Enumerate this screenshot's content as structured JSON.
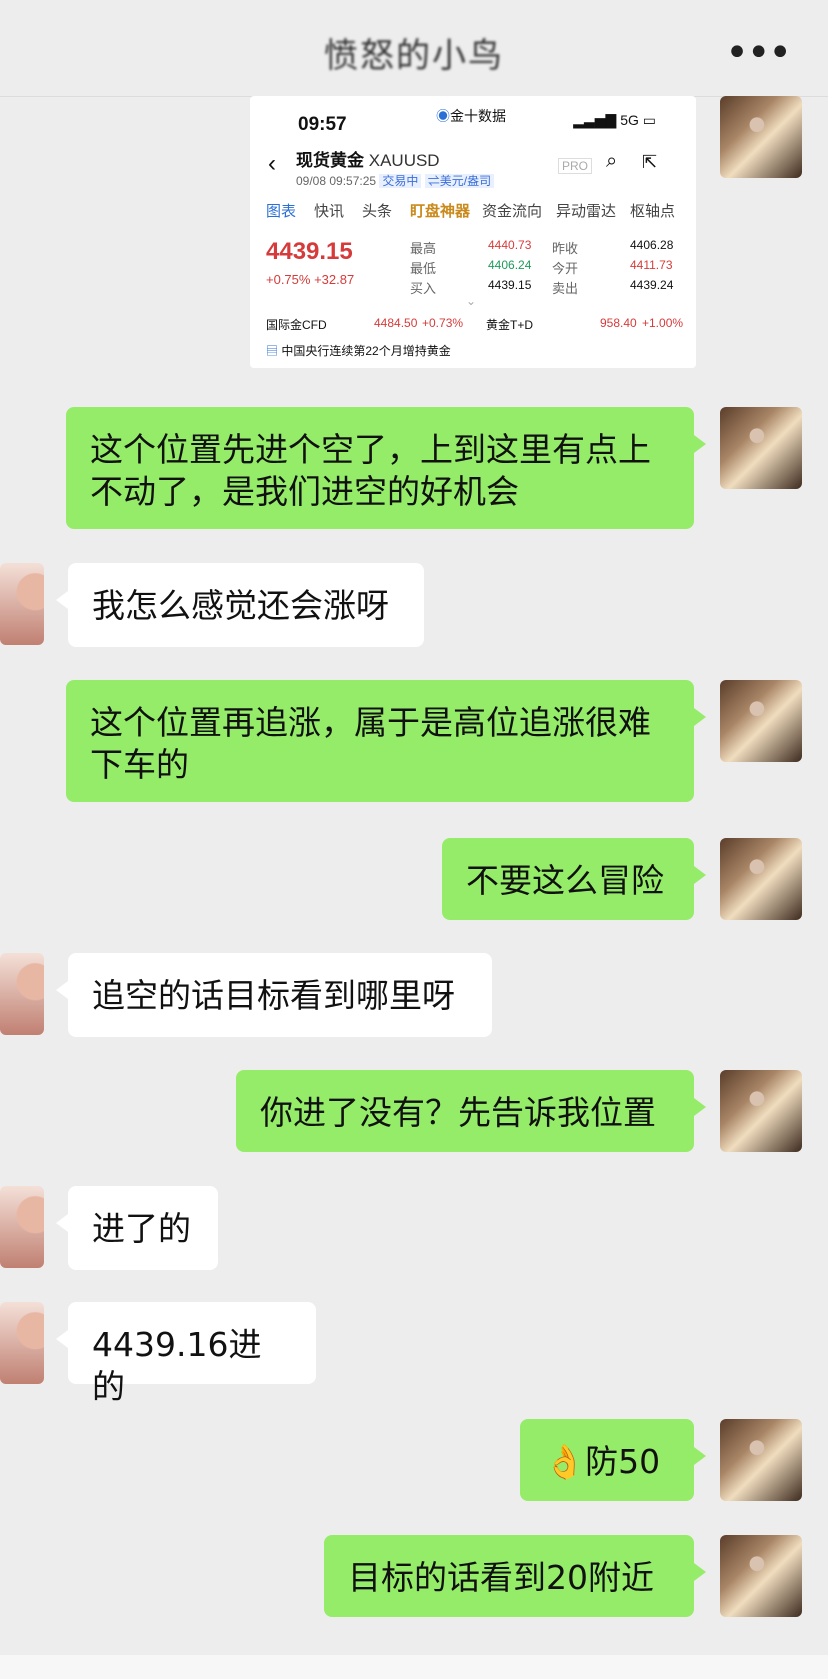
{
  "header": {
    "title": "愤怒的小鸟",
    "more": "•••"
  },
  "quote": {
    "status": {
      "time": "09:57",
      "app": "金十数据",
      "network": "5G"
    },
    "instrument": "现货黄金",
    "symbol": "XAUUSD",
    "datetime": "09/08 09:57:25",
    "badges": [
      "交易中",
      "⇌美元/盎司"
    ],
    "pro": "PRO",
    "tabs": [
      "图表",
      "快讯",
      "头条",
      "盯盘神器",
      "资金流向",
      "异动雷达",
      "枢轴点"
    ],
    "price": "4439.15",
    "change_pct": "+0.75%",
    "change_abs": "+32.87",
    "stats": {
      "high_label": "最高",
      "high": "4440.73",
      "low_label": "最低",
      "low": "4406.24",
      "bid_label": "买入",
      "bid": "4439.15",
      "prev_label": "昨收",
      "prev": "4406.28",
      "open_label": "今开",
      "open": "4411.73",
      "ask_label": "卖出",
      "ask": "4439.24"
    },
    "footer": {
      "cfd_label": "国际金CFD",
      "cfd_value": "4484.50",
      "cfd_change": "+0.73%",
      "td_label": "黄金T+D",
      "td_value": "958.40",
      "td_change": "+1.00%"
    },
    "news": "中国央行连续第22个月增持黄金"
  },
  "messages": [
    {
      "from": "me",
      "text": "这个位置先进个空了，上到这里有点上不动了，是我们进空的好机会"
    },
    {
      "from": "them",
      "text": "我怎么感觉还会涨呀"
    },
    {
      "from": "me",
      "text": "这个位置再追涨，属于是高位追涨很难下车的"
    },
    {
      "from": "me",
      "text": "不要这么冒险"
    },
    {
      "from": "them",
      "text": "追空的话目标看到哪里呀"
    },
    {
      "from": "me",
      "text": "你进了没有？先告诉我位置"
    },
    {
      "from": "them",
      "text": "进了的"
    },
    {
      "from": "them",
      "text": "4439.16进的"
    },
    {
      "from": "me",
      "text": "👌防50"
    },
    {
      "from": "me",
      "text": "目标的话看到20附近"
    }
  ]
}
